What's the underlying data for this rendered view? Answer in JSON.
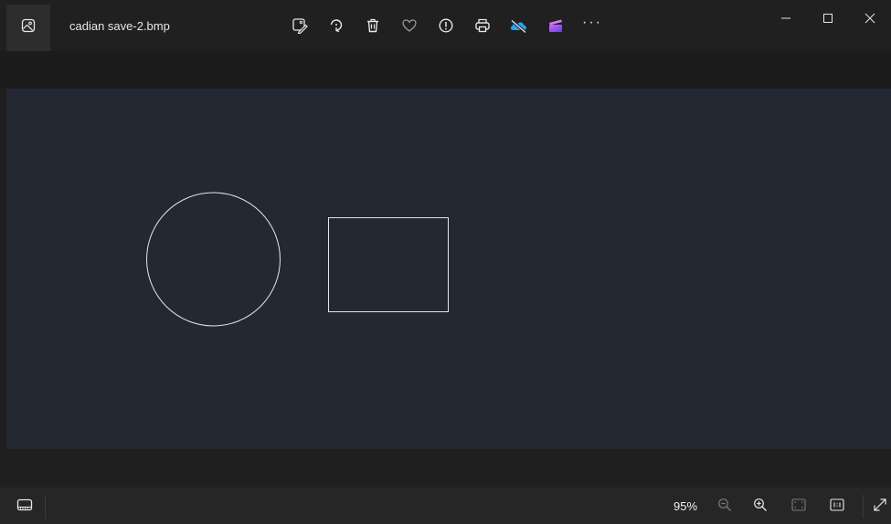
{
  "app": {
    "file_name": "cadian save-2.bmp",
    "more_label": "···"
  },
  "toolbar": {
    "buttons": [
      {
        "name": "edit-image-button",
        "icon": "edit-image-icon"
      },
      {
        "name": "rotate-button",
        "icon": "rotate-icon"
      },
      {
        "name": "delete-button",
        "icon": "trash-icon"
      },
      {
        "name": "favorite-button",
        "icon": "heart-icon"
      },
      {
        "name": "info-button",
        "icon": "info-icon"
      },
      {
        "name": "print-button",
        "icon": "printer-icon"
      },
      {
        "name": "onedrive-button",
        "icon": "onedrive-cloud-icon"
      },
      {
        "name": "clipchamp-button",
        "icon": "clipchamp-icon"
      }
    ]
  },
  "window_controls": [
    "minimize",
    "maximize",
    "close"
  ],
  "status": {
    "zoom": "95%"
  },
  "colors": {
    "titlebar": "#202020",
    "canvas": "#232832",
    "shape_stroke": "#e6e6e6",
    "onedrive_accent": "#2aa3f0",
    "clipchamp_accent": "#9b5cf0"
  }
}
